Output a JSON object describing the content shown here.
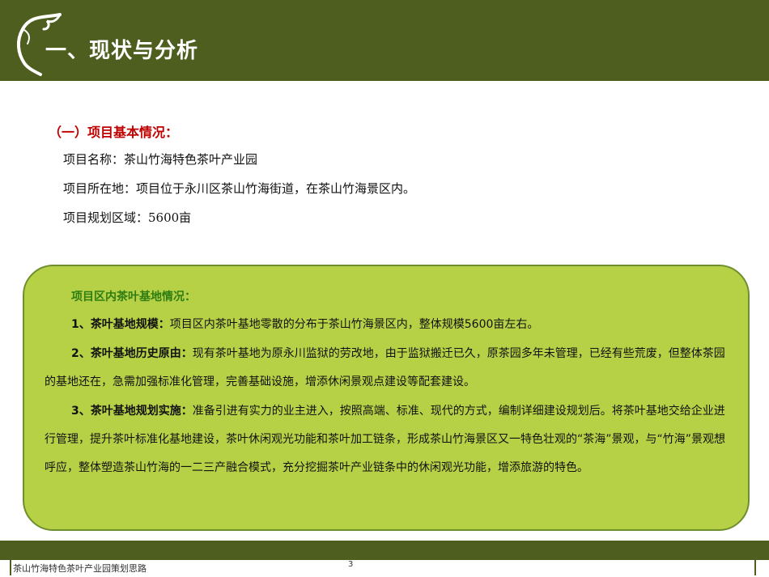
{
  "header": {
    "title": "一、现状与分析"
  },
  "intro": {
    "heading": "（一）项目基本情况：",
    "lines": [
      "项目名称：茶山竹海特色茶叶产业园",
      "项目所在地：项目位于永川区茶山竹海街道，在茶山竹海景区内。",
      "项目规划区域：5600亩"
    ]
  },
  "panel": {
    "heading": "项目区内茶叶基地情况：",
    "items": [
      {
        "label": "1、茶叶基地规模：",
        "text": "项目区内茶叶基地零散的分布于茶山竹海景区内，整体规模5600亩左右。"
      },
      {
        "label": "2、茶叶基地历史原由：",
        "text": "现有茶叶基地为原永川监狱的劳改地，由于监狱搬迁已久，原茶园多年未管理，已经有些荒废，但整体茶园的基地还在，急需加强标准化管理，完善基础设施，增添休闲景观点建设等配套建设。"
      },
      {
        "label": "3、茶叶基地规划实施：",
        "text": "准备引进有实力的业主进入，按照高端、标准、现代的方式，编制详细建设规划后。将茶叶基地交给企业进行管理，提升茶叶标准化基地建设，茶叶休闲观光功能和茶叶加工链条，形成茶山竹海景区又一特色壮观的“茶海”景观，与“竹海”景观想呼应，整体塑造茶山竹海的一二三产融合模式，充分挖掘茶叶产业链条中的休闲观光功能，增添旅游的特色。"
      }
    ]
  },
  "footer": {
    "title": "茶山竹海特色茶叶产业园策划思路",
    "page_number": "3"
  },
  "colors": {
    "header_bg": "#4d5e1f",
    "panel_bg": "#b7d146",
    "heading_red": "#c00000",
    "panel_heading_green": "#2e7d12"
  },
  "icons": {
    "header_logo": "tea-leaf-outline-icon"
  }
}
